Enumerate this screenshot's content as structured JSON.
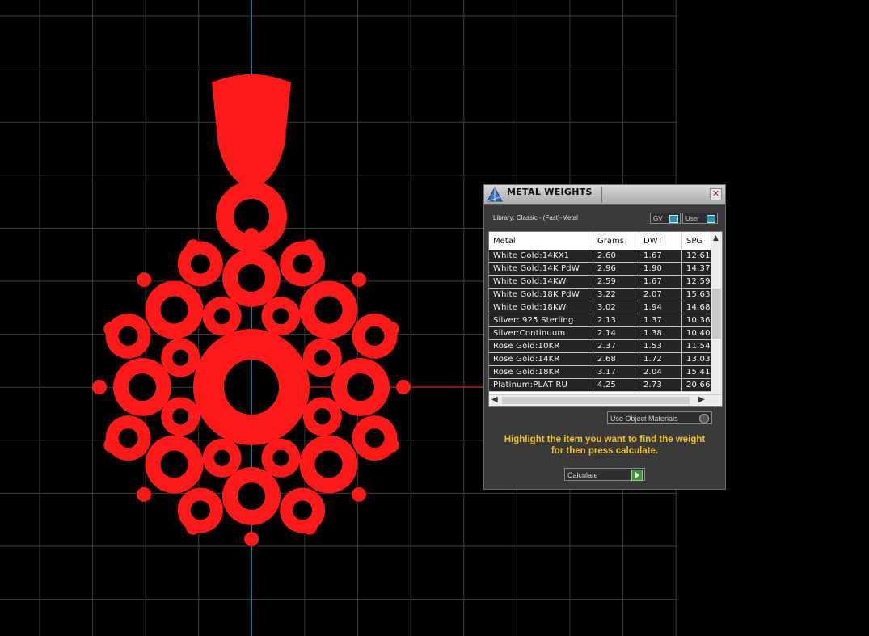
{
  "colors": {
    "model": "#ff1a1a",
    "grid": "#3d3d3d",
    "axis_y": "#2a8fb0",
    "axis_x": "#b01818",
    "hint": "#f2c21a"
  },
  "panel": {
    "title": "METAL WEIGHTS",
    "close_symbol": "✕",
    "library_label": "Library: Classic - (Fast)-Metal",
    "toggle_gv": "GV",
    "toggle_user": "User",
    "columns": [
      "Metal",
      "Grams",
      "DWT",
      "SPG"
    ],
    "rows": [
      [
        "White Gold:14KX1",
        "2.60",
        "1.67",
        "12.61"
      ],
      [
        "White Gold:14K PdW",
        "2.96",
        "1.90",
        "14.37"
      ],
      [
        "White Gold:14KW",
        "2.59",
        "1.67",
        "12.59"
      ],
      [
        "White Gold:18K PdW",
        "3.22",
        "2.07",
        "15.63"
      ],
      [
        "White Gold:18KW",
        "3.02",
        "1.94",
        "14.68"
      ],
      [
        "Silver:.925 Sterling",
        "2.13",
        "1.37",
        "10.36"
      ],
      [
        "Silver:Continuum",
        "2.14",
        "1.38",
        "10.40"
      ],
      [
        "Rose Gold:10KR",
        "2.37",
        "1.53",
        "11.54"
      ],
      [
        "Rose Gold:14KR",
        "2.68",
        "1.72",
        "13.03"
      ],
      [
        "Rose Gold:18KR",
        "3.17",
        "2.04",
        "15.41"
      ],
      [
        "Platinum:PLAT RU",
        "4.25",
        "2.73",
        "20.66"
      ]
    ],
    "use_object_materials": "Use Object Materials",
    "hint_line1": "Highlight the item you want to find the weight",
    "hint_line2": "for then press calculate.",
    "calculate_label": "Calculate"
  }
}
